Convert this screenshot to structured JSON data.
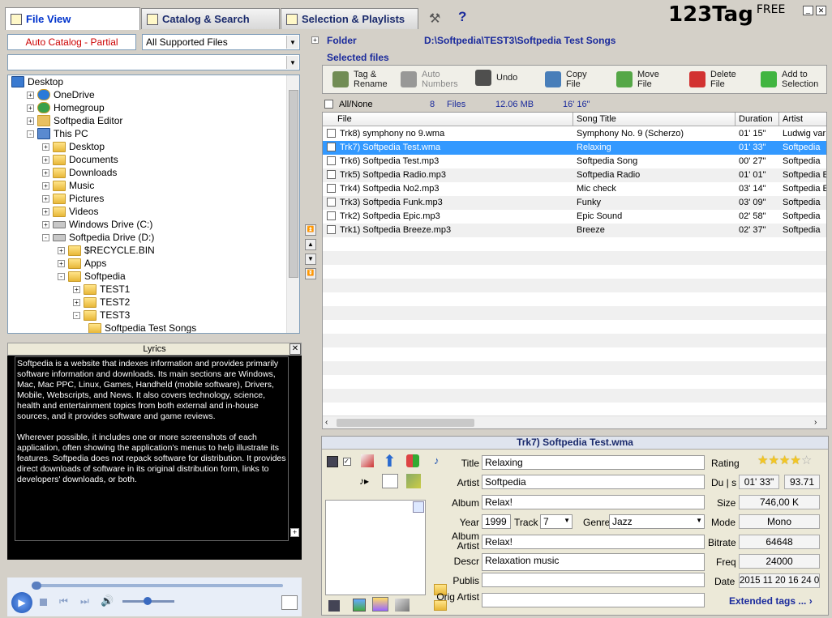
{
  "tabs": [
    {
      "label": "File View"
    },
    {
      "label": "Catalog & Search"
    },
    {
      "label": "Selection & Playlists"
    }
  ],
  "app_title": "123Tag",
  "app_badge": "FREE",
  "catalog_btn": "Auto Catalog - Partial",
  "filter": "All Supported Files",
  "second_combo": "",
  "tree": [
    {
      "label": "Desktop",
      "d": 0,
      "e": "",
      "icon": "desktop"
    },
    {
      "label": "OneDrive",
      "d": 1,
      "e": "+",
      "icon": "cloud"
    },
    {
      "label": "Homegroup",
      "d": 1,
      "e": "+",
      "icon": "homegroup"
    },
    {
      "label": "Softpedia Editor",
      "d": 1,
      "e": "+",
      "icon": "user"
    },
    {
      "label": "This PC",
      "d": 1,
      "e": "-",
      "icon": "pc"
    },
    {
      "label": "Desktop",
      "d": 2,
      "e": "+",
      "icon": "folder"
    },
    {
      "label": "Documents",
      "d": 2,
      "e": "+",
      "icon": "folder"
    },
    {
      "label": "Downloads",
      "d": 2,
      "e": "+",
      "icon": "folder"
    },
    {
      "label": "Music",
      "d": 2,
      "e": "+",
      "icon": "folder"
    },
    {
      "label": "Pictures",
      "d": 2,
      "e": "+",
      "icon": "folder"
    },
    {
      "label": "Videos",
      "d": 2,
      "e": "+",
      "icon": "folder"
    },
    {
      "label": "Windows Drive (C:)",
      "d": 2,
      "e": "+",
      "icon": "drive"
    },
    {
      "label": "Softpedia Drive (D:)",
      "d": 2,
      "e": "-",
      "icon": "drive"
    },
    {
      "label": "$RECYCLE.BIN",
      "d": 3,
      "e": "+",
      "icon": "folder"
    },
    {
      "label": "Apps",
      "d": 3,
      "e": "+",
      "icon": "folder"
    },
    {
      "label": "Softpedia",
      "d": 3,
      "e": "-",
      "icon": "folder"
    },
    {
      "label": "TEST1",
      "d": 4,
      "e": "+",
      "icon": "folder"
    },
    {
      "label": "TEST2",
      "d": 4,
      "e": "+",
      "icon": "folder"
    },
    {
      "label": "TEST3",
      "d": 4,
      "e": "-",
      "icon": "folder"
    },
    {
      "label": "Softpedia Test Songs",
      "d": 5,
      "e": "",
      "icon": "folder"
    }
  ],
  "lyrics_title": "Lyrics",
  "lyrics_p1": "Softpedia is a website that indexes information and provides primarily software information and downloads. Its main sections are Windows, Mac, Mac PPC, Linux, Games, Handheld (mobile software), Drivers, Mobile, Webscripts, and News. It also covers technology, science, health and entertainment topics from both external and in-house sources, and it provides software and game reviews.",
  "lyrics_p2": "Wherever possible, it includes one or more screenshots of each application, often showing the application's menus to help illustrate its features. Softpedia does not repack software for distribution. It provides direct downloads of software in its original distribution form, links to developers' downloads, or both.",
  "folder_label": "Folder",
  "folder_path": "D:\\Softpedia\\TEST3\\Softpedia Test Songs",
  "selected_files_label": "Selected files",
  "toolbar": [
    {
      "label": "Tag & Rename",
      "icon": "tag-rename",
      "color": "#5a7a3a"
    },
    {
      "label": "Auto Numbers",
      "icon": "auto-numbers",
      "color": "#888888"
    },
    {
      "label": "Undo",
      "icon": "undo",
      "color": "#333333"
    },
    {
      "label": "Copy File",
      "icon": "copy-file",
      "color": "#2a6ab0"
    },
    {
      "label": "Move File",
      "icon": "move-file",
      "color": "#3a9a2a"
    },
    {
      "label": "Delete File",
      "icon": "delete-file",
      "color": "#cc1111"
    },
    {
      "label": "Add to Selection",
      "icon": "add-to-selection",
      "color": "#22aa22"
    }
  ],
  "summary": {
    "allnone": "All/None",
    "count": "8",
    "files": "Files",
    "size": "12.06 MB",
    "time": "16' 16\""
  },
  "columns": [
    "File",
    "Song Title",
    "Duration",
    "Artist"
  ],
  "rows": [
    [
      "Trk8) symphony no 9.wma",
      "Symphony No. 9 (Scherzo)",
      "01' 15\"",
      "Ludwig var"
    ],
    [
      "Trk7) Softpedia Test.wma",
      "Relaxing",
      "01' 33\"",
      "Softpedia"
    ],
    [
      "Trk6) Softpedia Test.mp3",
      "Softpedia Song",
      "00' 27\"",
      "Softpedia"
    ],
    [
      "Trk5) Softpedia Radio.mp3",
      "Softpedia Radio",
      "01' 01\"",
      "Softpedia E"
    ],
    [
      "Trk4) Softpedia No2.mp3",
      "Mic check",
      "03' 14\"",
      "Softpedia E"
    ],
    [
      "Trk3) Softpedia Funk.mp3",
      "Funky",
      "03' 09\"",
      "Softpedia"
    ],
    [
      "Trk2) Softpedia Epic.mp3",
      "Epic Sound",
      "02' 58\"",
      "Softpedia"
    ],
    [
      "Trk1) Softpedia Breeze.mp3",
      "Breeze",
      "02' 37\"",
      "Softpedia"
    ]
  ],
  "selected_row": 1,
  "tag": {
    "header": "Trk7) Softpedia Test.wma",
    "title_lbl": "Title",
    "title": "Relaxing",
    "artist_lbl": "Artist",
    "artist": "Softpedia",
    "album_lbl": "Album",
    "album": "Relax!",
    "year_lbl": "Year",
    "year": "1999",
    "track_lbl": "Track",
    "track": "7",
    "genre_lbl": "Genre",
    "genre": "Jazz",
    "albumartist_lbl": "Album Artist",
    "albumartist": "Relax!",
    "descr_lbl": "Descr",
    "descr": "Relaxation music",
    "publis_lbl": "Publis",
    "publis": "",
    "origartist_lbl": "Orig Artist",
    "origartist": "",
    "rating_lbl": "Rating",
    "rating": 4,
    "duls_lbl": "Du | s",
    "dur": "01' 33\"",
    "secs": "93.71",
    "size_lbl": "Size",
    "size": "746,00 K",
    "mode_lbl": "Mode",
    "mode": "Mono",
    "bitrate_lbl": "Bitrate",
    "bitrate": "64648",
    "freq_lbl": "Freq",
    "freq": "24000",
    "date_lbl": "Date",
    "date": "2015 11 20 16 24 00",
    "extended": "Extended tags ..."
  },
  "colors": {
    "selection": "#3399ff",
    "link": "#0000cc"
  }
}
